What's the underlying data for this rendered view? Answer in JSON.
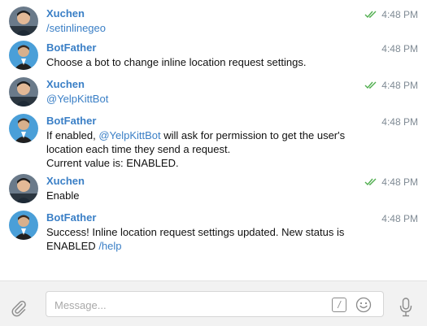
{
  "messages": [
    {
      "sender": "Xuchen",
      "time": "4:48 PM",
      "read": true,
      "parts": [
        {
          "text": "/setinlinegeo",
          "kind": "cmd"
        }
      ]
    },
    {
      "sender": "BotFather",
      "time": "4:48 PM",
      "read": false,
      "lines": [
        "Choose a bot to change inline location request settings."
      ]
    },
    {
      "sender": "Xuchen",
      "time": "4:48 PM",
      "read": true,
      "mention": "@YelpKittBot"
    },
    {
      "sender": "BotFather",
      "time": "4:48 PM",
      "read": false,
      "line1_pre": "If enabled, ",
      "line1_mention": "@YelpKittBot",
      "line1_post": " will ask for permission to get the user's",
      "line2": "location each time they send a request.",
      "line3": "Current value is: ENABLED."
    },
    {
      "sender": "Xuchen",
      "time": "4:48 PM",
      "read": true,
      "lines": [
        "Enable"
      ]
    },
    {
      "sender": "BotFather",
      "time": "4:48 PM",
      "read": false,
      "line1": "Success! Inline location request settings updated. New status is",
      "line2_pre": "ENABLED ",
      "line2_cmd": "/help"
    }
  ],
  "compose": {
    "placeholder": "Message...",
    "command_glyph": "/"
  },
  "colors": {
    "accent": "#3a7fc6",
    "check": "#4fae4e",
    "time": "#7f8a94"
  },
  "icons": [
    "paperclip-icon",
    "slash-command-icon",
    "emoji-icon",
    "microphone-icon",
    "double-check-icon"
  ]
}
